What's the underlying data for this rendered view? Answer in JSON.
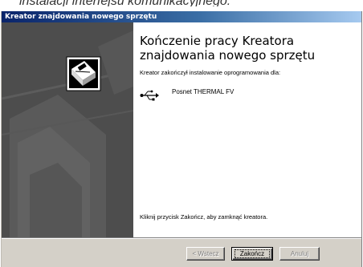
{
  "caption": "instalacji interfejsu komunikacyjnego.",
  "window": {
    "title": "Kreator znajdowania nowego sprzętu"
  },
  "main": {
    "heading": "Kończenie pracy Kreatora znajdowania nowego sprzętu",
    "subtitle": "Kreator zakończył instalowanie oprogramowania dla:",
    "device_name": "Posnet THERMAL FV",
    "device_icon": "usb-icon",
    "instruction": "Kliknij przycisk Zakończ, aby zamknąć kreatora."
  },
  "buttons": {
    "back_label": "< Wstecz",
    "finish_label": "Zakończ",
    "cancel_label": "Anuluj"
  }
}
